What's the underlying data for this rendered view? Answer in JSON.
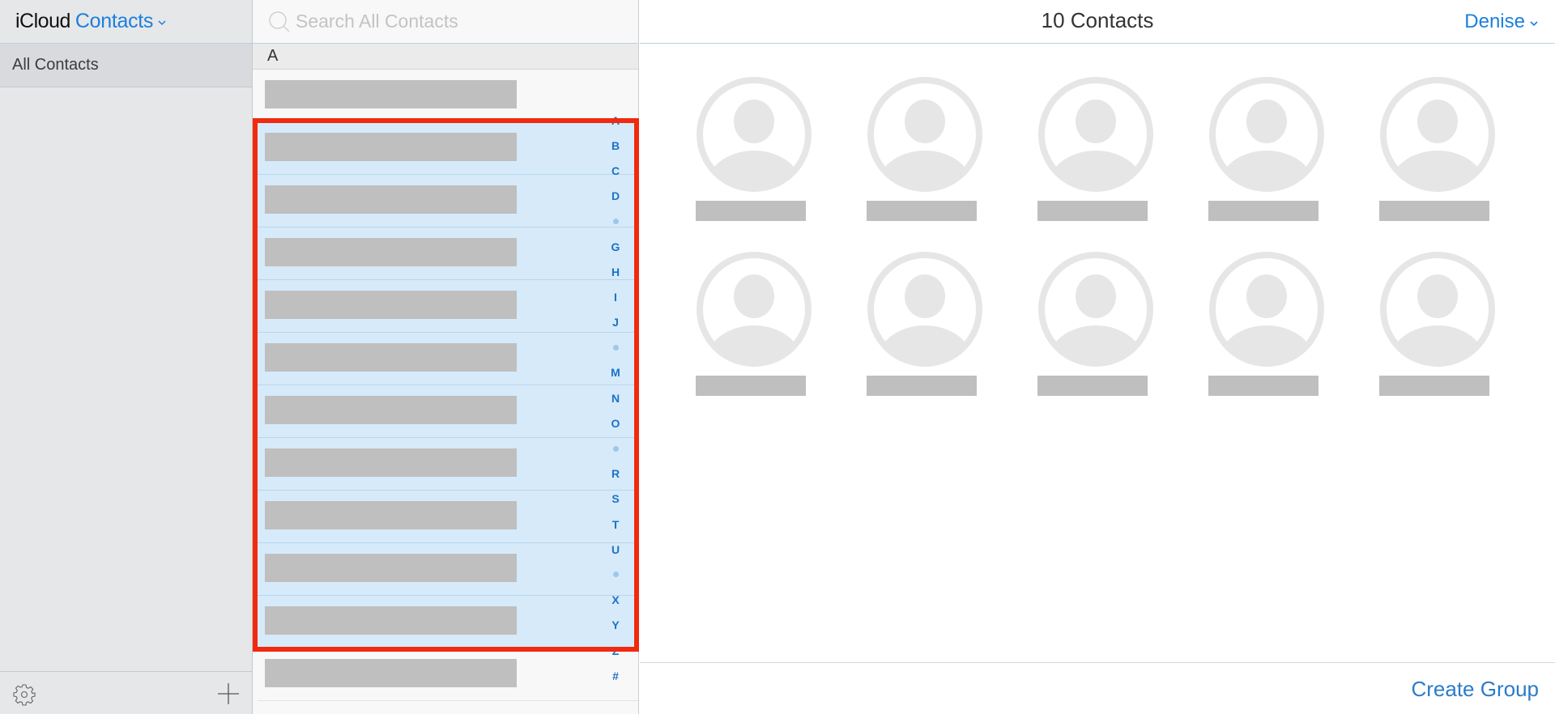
{
  "sidebar": {
    "app_name": "iCloud",
    "product_name": "Contacts",
    "groups": [
      {
        "label": "All Contacts",
        "selected": true
      }
    ],
    "footer": {
      "settings_icon": "gear-icon",
      "add_icon": "plus-icon"
    }
  },
  "list": {
    "search_placeholder": "Search All Contacts",
    "search_value": "",
    "section_header": "A",
    "rows": [
      {
        "name": "[redacted]",
        "selected": false
      },
      {
        "name": "[redacted]",
        "selected": true
      },
      {
        "name": "[redacted]",
        "selected": true
      },
      {
        "name": "[redacted]",
        "selected": true
      },
      {
        "name": "[redacted]",
        "selected": true
      },
      {
        "name": "[redacted]",
        "selected": true
      },
      {
        "name": "[redacted]",
        "selected": true
      },
      {
        "name": "[redacted]",
        "selected": true
      },
      {
        "name": "[redacted]",
        "selected": true
      },
      {
        "name": "[redacted]",
        "selected": true
      },
      {
        "name": "[redacted]",
        "selected": true
      },
      {
        "name": "[redacted]",
        "selected": false
      }
    ],
    "index": [
      "A",
      "B",
      "C",
      "D",
      "•",
      "G",
      "H",
      "I",
      "J",
      "•",
      "M",
      "N",
      "O",
      "•",
      "R",
      "S",
      "T",
      "U",
      "•",
      "X",
      "Y",
      "Z",
      "#"
    ]
  },
  "main": {
    "title": "10 Contacts",
    "user_name": "Denise",
    "cards": [
      {
        "name": "[redacted]"
      },
      {
        "name": "[redacted]"
      },
      {
        "name": "[redacted]"
      },
      {
        "name": "[redacted]"
      },
      {
        "name": "[redacted]"
      },
      {
        "name": "[redacted]"
      },
      {
        "name": "[redacted]"
      },
      {
        "name": "[redacted]"
      },
      {
        "name": "[redacted]"
      },
      {
        "name": "[redacted]"
      }
    ],
    "create_group_label": "Create Group"
  },
  "colors": {
    "accent": "#1c7fdc",
    "selection": "#d6eaf9",
    "highlight_box": "#f02a10",
    "redaction": "#bfbfbf"
  }
}
